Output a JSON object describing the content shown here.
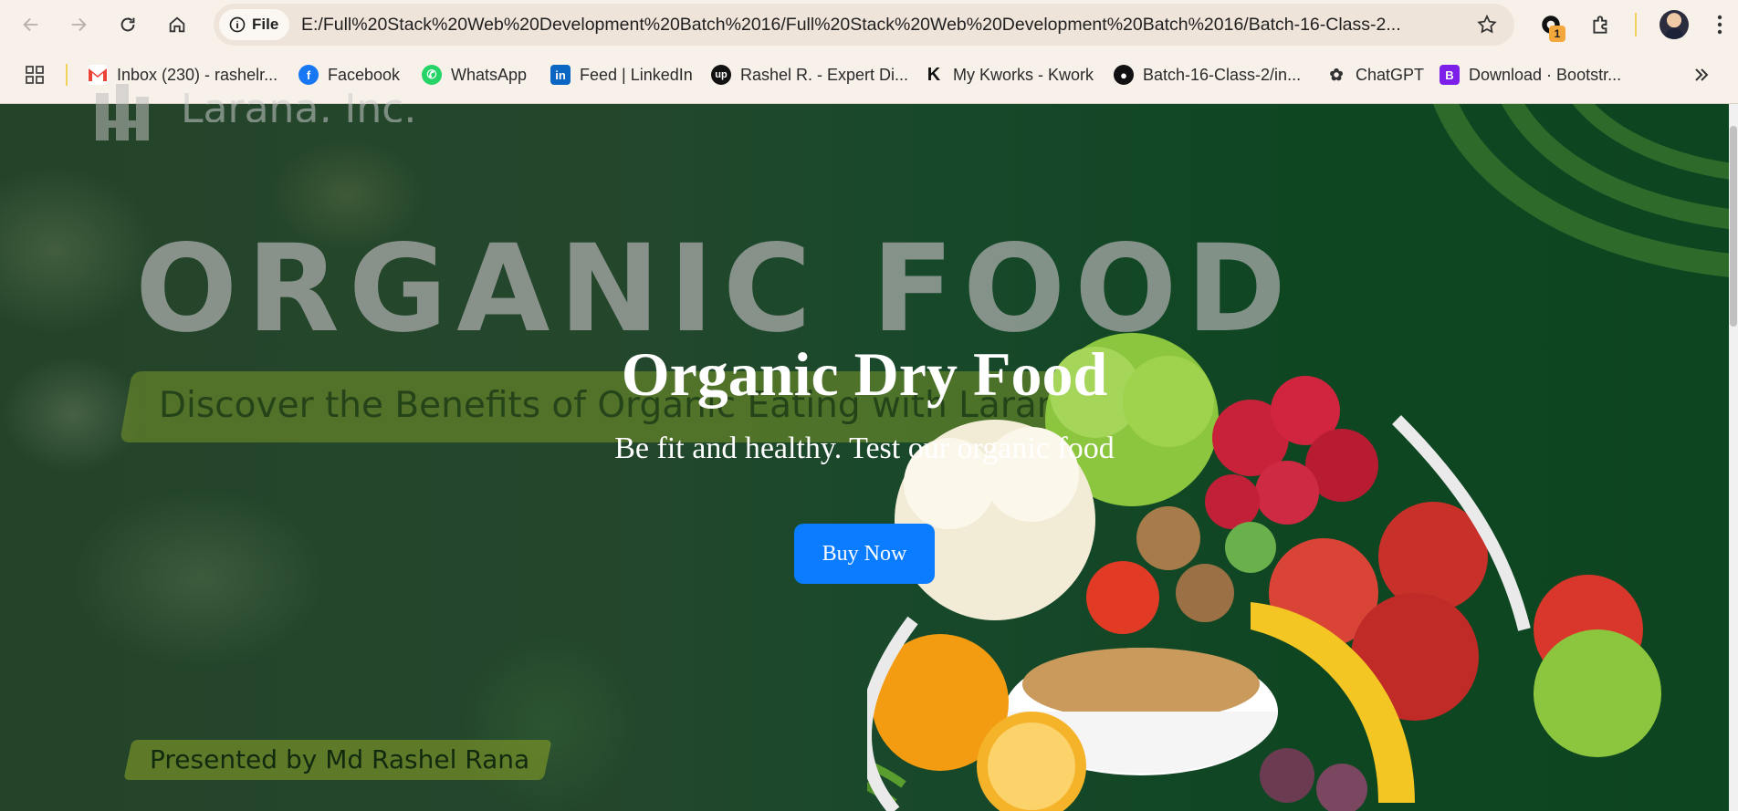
{
  "browser": {
    "url_chip_label": "File",
    "url": "E:/Full%20Stack%20Web%20Development%20Batch%2016/Full%20Stack%20Web%20Development%20Batch%2016/Batch-16-Class-2...",
    "extension_badge": "1"
  },
  "bookmarks": [
    {
      "label": "Inbox (230) - rashelr...",
      "icon": "gmail-icon"
    },
    {
      "label": "Facebook",
      "icon": "facebook-icon"
    },
    {
      "label": "WhatsApp",
      "icon": "whatsapp-icon"
    },
    {
      "label": "Feed | LinkedIn",
      "icon": "linkedin-icon"
    },
    {
      "label": "Rashel R. - Expert Di...",
      "icon": "upwork-icon"
    },
    {
      "label": "My Kworks - Kwork",
      "icon": "kwork-icon"
    },
    {
      "label": "Batch-16-Class-2/in...",
      "icon": "github-icon"
    },
    {
      "label": "ChatGPT",
      "icon": "chatgpt-icon"
    },
    {
      "label": "Download · Bootstr...",
      "icon": "bootstrap-icon"
    }
  ],
  "hero": {
    "logo_text": "Larana, Inc.",
    "background_headline": "ORGANIC FOOD",
    "background_tagline": "Discover the Benefits of Organic Eating with Larana, Inc.",
    "presented_by": "Presented by Md Rashel Rana",
    "title": "Organic Dry Food",
    "subtitle": "Be fit and healthy. Test our organic food",
    "cta_label": "Buy Now"
  },
  "colors": {
    "cta": "#0a7cff",
    "hero_bg": "#0f4622",
    "chrome_bg": "#f8f1ea"
  }
}
